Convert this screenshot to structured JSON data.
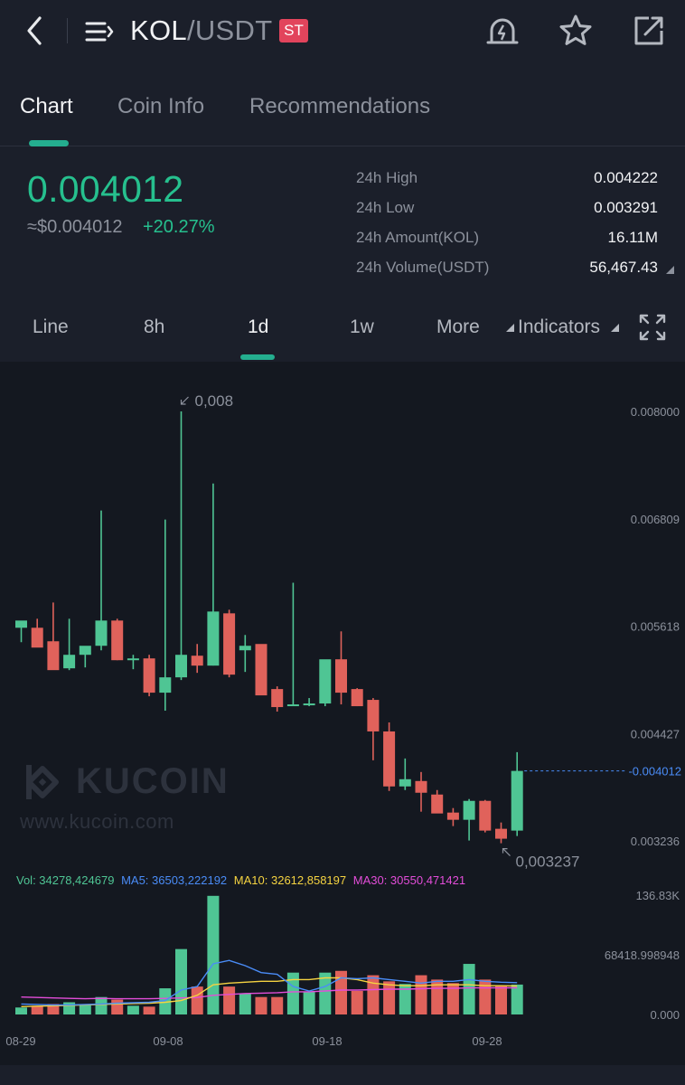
{
  "header": {
    "base": "KOL",
    "slash": "/",
    "quote": "USDT",
    "badge": "ST"
  },
  "tabs": [
    "Chart",
    "Coin Info",
    "Recommendations"
  ],
  "price": {
    "last": "0.004012",
    "usd": "≈$0.004012",
    "change": "+20.27%"
  },
  "stats": [
    {
      "label": "24h High",
      "value": "0.004222"
    },
    {
      "label": "24h Low",
      "value": "0.003291"
    },
    {
      "label": "24h Amount(KOL)",
      "value": "16.11M"
    },
    {
      "label": "24h Volume(USDT)",
      "value": "56,467.43"
    }
  ],
  "periods": {
    "line": "Line",
    "h8": "8h",
    "d1": "1d",
    "w1": "1w",
    "more": "More",
    "indicators": "Indicators"
  },
  "watermark": {
    "name": "KUCOIN",
    "url": "www.kucoin.com"
  },
  "colors": {
    "up": "#4fc594",
    "down": "#e0625b",
    "accent": "#24ae8f",
    "ma5": "#4a8cf7",
    "ma10": "#f5d341",
    "ma30": "#e34dd9",
    "vol_label": "#4fc594"
  },
  "volume_legend": {
    "vol": "Vol: 34278,424679",
    "ma5": "MA5: 36503,222192",
    "ma10": "MA10: 32612,858197",
    "ma30": "MA30: 30550,471421"
  },
  "chart_data": {
    "type": "candlestick",
    "price_axis": {
      "ticks": [
        "0.008000",
        "0.006809",
        "0.005618",
        "0.004427",
        "0.003236"
      ],
      "ylim": [
        0.003236,
        0.008
      ]
    },
    "current_price_label": "0.004012",
    "max_label": "0,008",
    "min_label": "0,003237",
    "x_labels": [
      "08-29",
      "09-08",
      "09-18",
      "09-28"
    ],
    "candles": [
      {
        "o": 0.0056,
        "h": 0.00566,
        "l": 0.00544,
        "c": 0.00568
      },
      {
        "o": 0.0056,
        "h": 0.0057,
        "l": 0.0054,
        "c": 0.00538
      },
      {
        "o": 0.00545,
        "h": 0.00588,
        "l": 0.00515,
        "c": 0.00513
      },
      {
        "o": 0.00515,
        "h": 0.0057,
        "l": 0.00513,
        "c": 0.0053
      },
      {
        "o": 0.0053,
        "h": 0.00535,
        "l": 0.00516,
        "c": 0.0054
      },
      {
        "o": 0.0054,
        "h": 0.0069,
        "l": 0.00535,
        "c": 0.00568
      },
      {
        "o": 0.00568,
        "h": 0.0057,
        "l": 0.00524,
        "c": 0.00524
      },
      {
        "o": 0.00526,
        "h": 0.0053,
        "l": 0.00514,
        "c": 0.00526
      },
      {
        "o": 0.00526,
        "h": 0.0053,
        "l": 0.00484,
        "c": 0.00488
      },
      {
        "o": 0.00488,
        "h": 0.0068,
        "l": 0.00468,
        "c": 0.00505
      },
      {
        "o": 0.00505,
        "h": 0.008,
        "l": 0.00502,
        "c": 0.0053
      },
      {
        "o": 0.00529,
        "h": 0.00542,
        "l": 0.0051,
        "c": 0.00518
      },
      {
        "o": 0.00518,
        "h": 0.0072,
        "l": 0.00518,
        "c": 0.00578
      },
      {
        "o": 0.00576,
        "h": 0.0058,
        "l": 0.00505,
        "c": 0.00508
      },
      {
        "o": 0.00535,
        "h": 0.00552,
        "l": 0.00511,
        "c": 0.0054
      },
      {
        "o": 0.00542,
        "h": 0.0054,
        "l": 0.00486,
        "c": 0.00485
      },
      {
        "o": 0.00492,
        "h": 0.00495,
        "l": 0.00467,
        "c": 0.00472
      },
      {
        "o": 0.00473,
        "h": 0.0061,
        "l": 0.00473,
        "c": 0.00475
      },
      {
        "o": 0.00474,
        "h": 0.00482,
        "l": 0.00473,
        "c": 0.00476
      },
      {
        "o": 0.00476,
        "h": 0.00518,
        "l": 0.00473,
        "c": 0.00525
      },
      {
        "o": 0.00525,
        "h": 0.00556,
        "l": 0.00475,
        "c": 0.00488
      },
      {
        "o": 0.00492,
        "h": 0.00493,
        "l": 0.00473,
        "c": 0.00473
      },
      {
        "o": 0.0048,
        "h": 0.00482,
        "l": 0.00413,
        "c": 0.00445
      },
      {
        "o": 0.00445,
        "h": 0.00455,
        "l": 0.00379,
        "c": 0.00384
      },
      {
        "o": 0.00384,
        "h": 0.00415,
        "l": 0.0038,
        "c": 0.00392
      },
      {
        "o": 0.0039,
        "h": 0.004,
        "l": 0.00356,
        "c": 0.00377
      },
      {
        "o": 0.00375,
        "h": 0.0038,
        "l": 0.00358,
        "c": 0.00354
      },
      {
        "o": 0.00355,
        "h": 0.0036,
        "l": 0.0034,
        "c": 0.00347
      },
      {
        "o": 0.00347,
        "h": 0.0037,
        "l": 0.00324,
        "c": 0.00368
      },
      {
        "o": 0.00368,
        "h": 0.00369,
        "l": 0.00333,
        "c": 0.00335
      },
      {
        "o": 0.00337,
        "h": 0.00344,
        "l": 0.00321,
        "c": 0.00326
      },
      {
        "o": 0.00335,
        "h": 0.00422,
        "l": 0.00329,
        "c": 0.004012
      }
    ],
    "volume_axis": {
      "ticks": [
        "136.83K",
        "68418.998948",
        "0.000"
      ],
      "ylim": [
        0,
        136830
      ]
    },
    "volume": [
      8000,
      10000,
      12000,
      14000,
      11000,
      20000,
      17000,
      10000,
      9000,
      30000,
      75000,
      32000,
      136000,
      32000,
      24000,
      20000,
      20000,
      48000,
      26000,
      48000,
      50000,
      27000,
      45000,
      38000,
      35000,
      45000,
      40000,
      36000,
      58000,
      40000,
      33000,
      34278
    ],
    "ma5": [
      12000,
      11500,
      11000,
      11000,
      11500,
      12000,
      13000,
      13500,
      14000,
      16000,
      28000,
      32000,
      58000,
      62000,
      56000,
      48000,
      46000,
      32000,
      27000,
      32000,
      42000,
      41000,
      42000,
      40000,
      38000,
      36000,
      38000,
      38000,
      40000,
      38000,
      37000,
      36503
    ],
    "ma10": [
      9000,
      9500,
      10000,
      10500,
      11000,
      11500,
      12000,
      12500,
      13000,
      14000,
      16000,
      22000,
      34000,
      36000,
      37000,
      38000,
      38000,
      40000,
      40000,
      42000,
      42000,
      40000,
      36000,
      34000,
      33000,
      33000,
      34000,
      34000,
      34000,
      33000,
      33000,
      32612
    ],
    "ma30": [
      20000,
      19500,
      19000,
      18500,
      18000,
      18500,
      18000,
      18000,
      18000,
      18500,
      19000,
      19500,
      22000,
      23000,
      24000,
      24500,
      25000,
      26000,
      26000,
      27000,
      28000,
      28000,
      28500,
      29000,
      29000,
      29500,
      30000,
      30000,
      30500,
      30500,
      30500,
      30550
    ]
  }
}
